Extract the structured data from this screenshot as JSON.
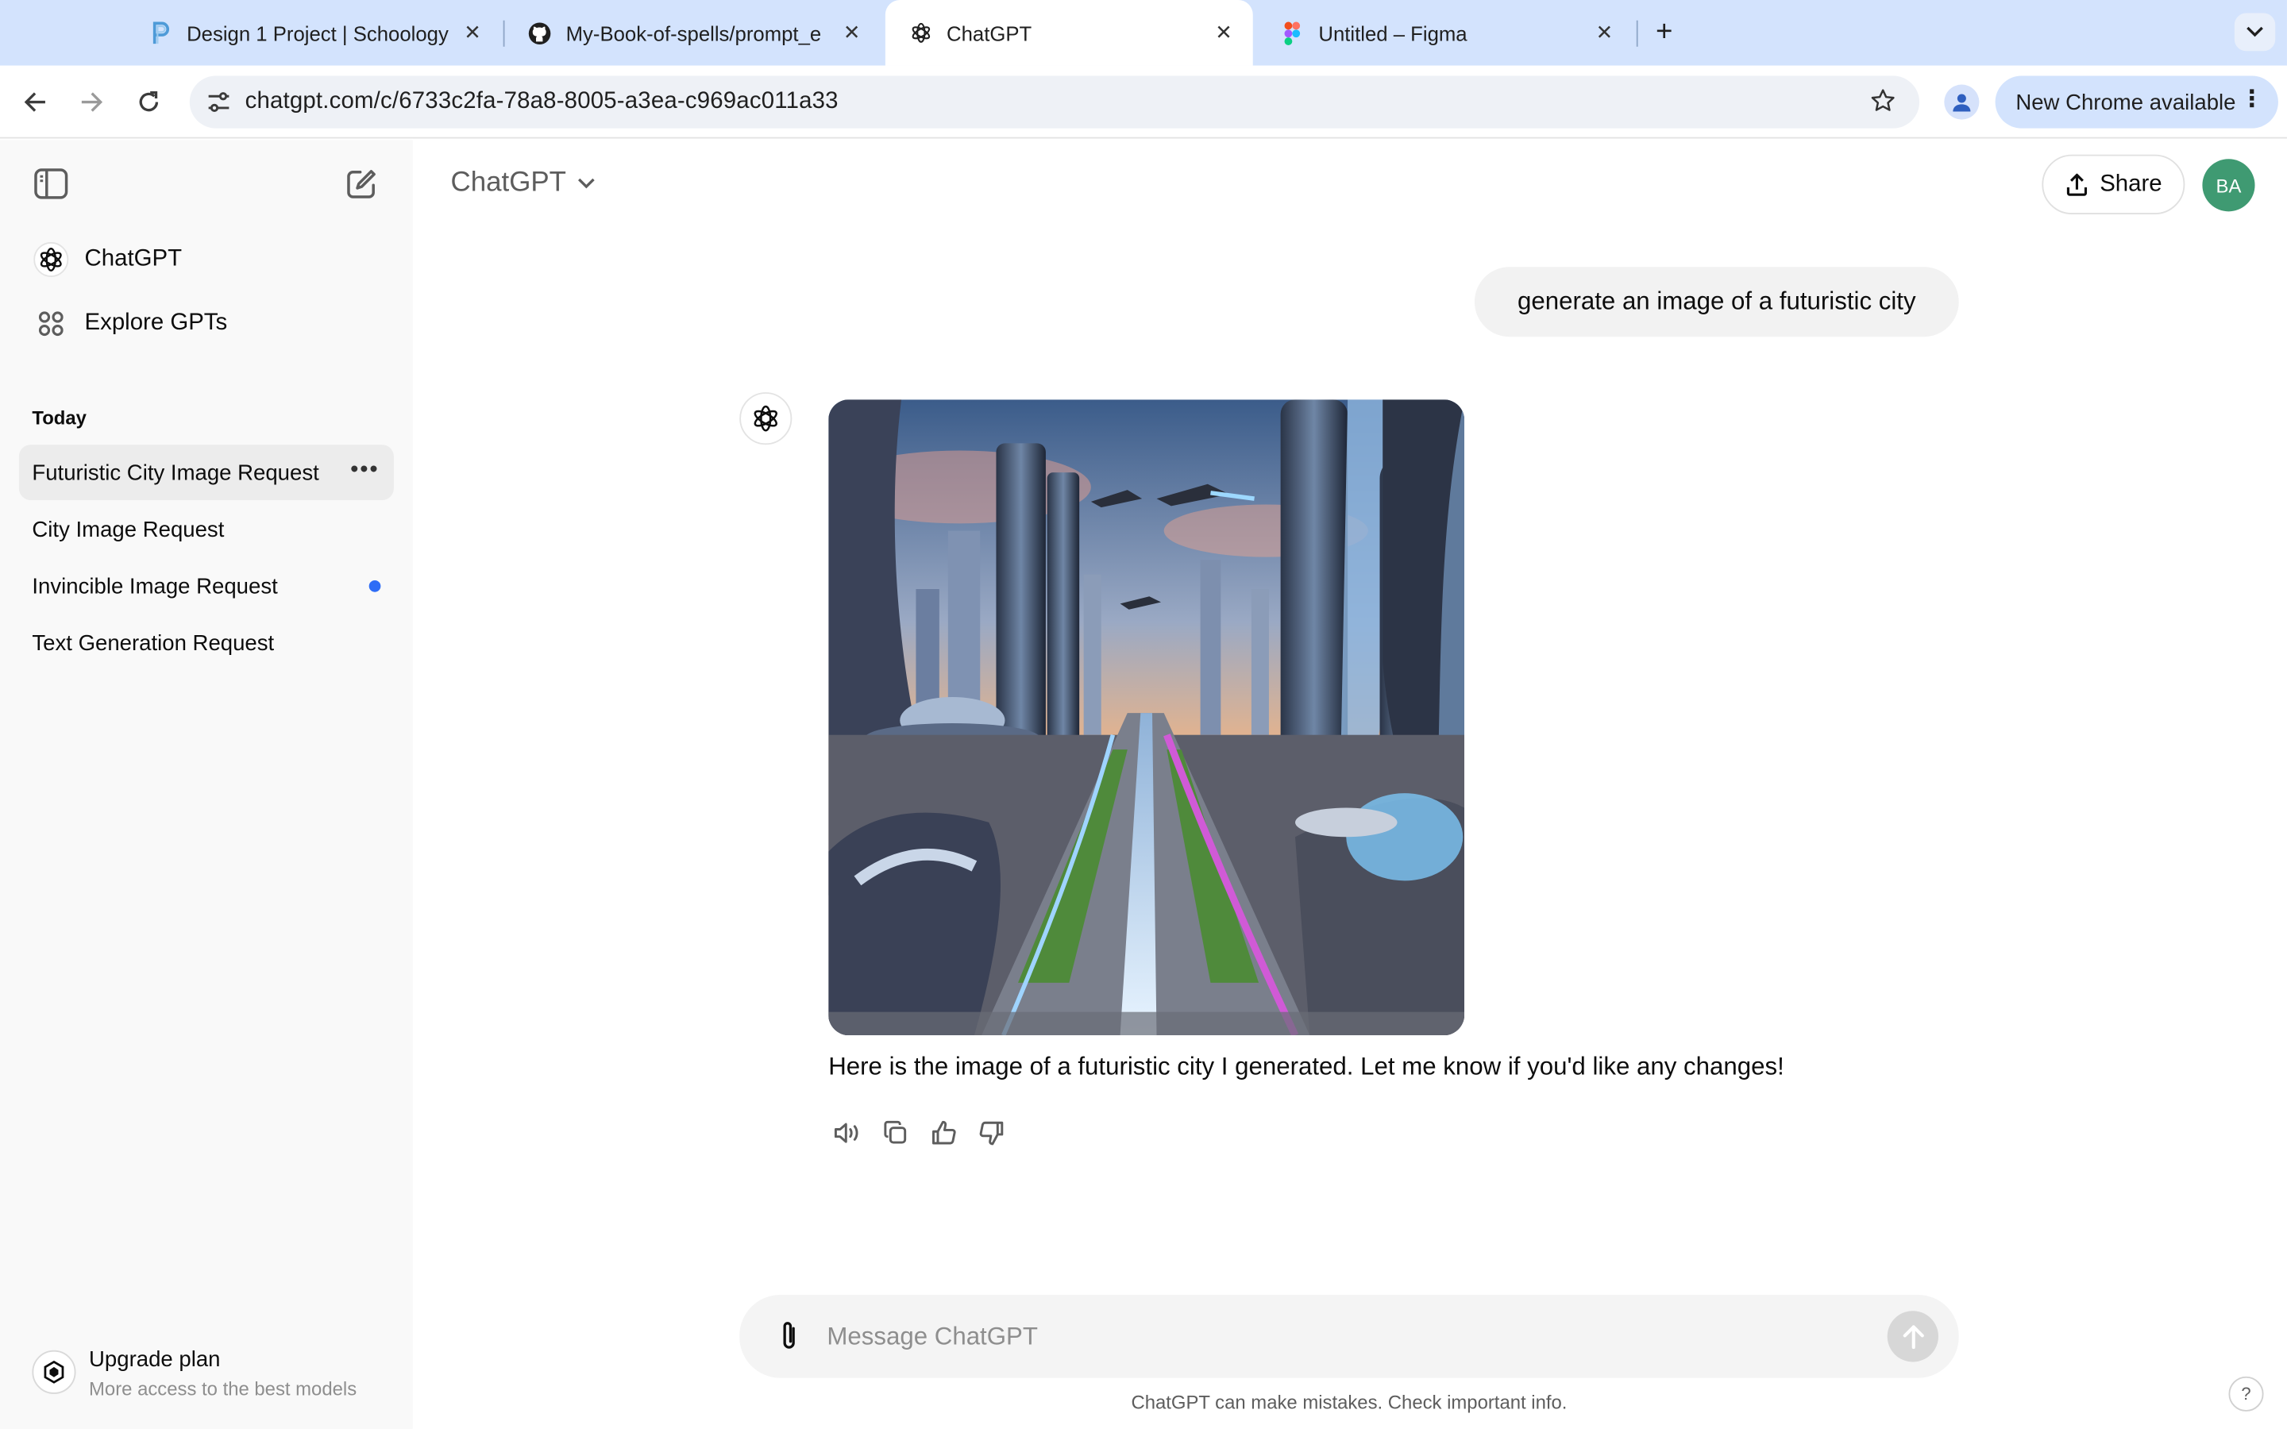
{
  "browser": {
    "tabs": [
      {
        "label": "Design 1 Project | Schoology",
        "icon": "schoology-icon",
        "active": false
      },
      {
        "label": "My-Book-of-spells/prompt_e",
        "icon": "github-icon",
        "active": false
      },
      {
        "label": "ChatGPT",
        "icon": "openai-icon",
        "active": true
      },
      {
        "label": "Untitled – Figma",
        "icon": "figma-icon",
        "active": false
      }
    ],
    "url": "chatgpt.com/c/6733c2fa-78a8-8005-a3ea-c969ac011a33",
    "update_label": "New Chrome available"
  },
  "sidebar": {
    "nav": [
      {
        "label": "ChatGPT",
        "icon": "openai-icon"
      },
      {
        "label": "Explore GPTs",
        "icon": "grid-icon"
      }
    ],
    "section_label": "Today",
    "chats": [
      {
        "label": "Futuristic City Image Request",
        "active": true
      },
      {
        "label": "City Image Request",
        "active": false
      },
      {
        "label": "Invincible Image Request",
        "active": false,
        "unread": true
      },
      {
        "label": "Text Generation Request",
        "active": false
      }
    ],
    "upgrade": {
      "title": "Upgrade plan",
      "subtitle": "More access to the best models"
    }
  },
  "header": {
    "model_label": "ChatGPT",
    "share_label": "Share",
    "avatar_initials": "BA"
  },
  "conversation": {
    "user_message": "generate an image of a futuristic city",
    "assistant_reply": "Here is the image of a futuristic city I generated. Let me know if you'd like any changes!"
  },
  "composer": {
    "placeholder": "Message ChatGPT",
    "value": ""
  },
  "footer": {
    "disclaimer": "ChatGPT can make mistakes. Check important info.",
    "help_label": "?"
  },
  "colors": {
    "tabstrip": "#d3e3fd",
    "sidebar": "#f9f9f9",
    "avatar": "#3f9a72",
    "unread_dot": "#2e6cf6"
  }
}
